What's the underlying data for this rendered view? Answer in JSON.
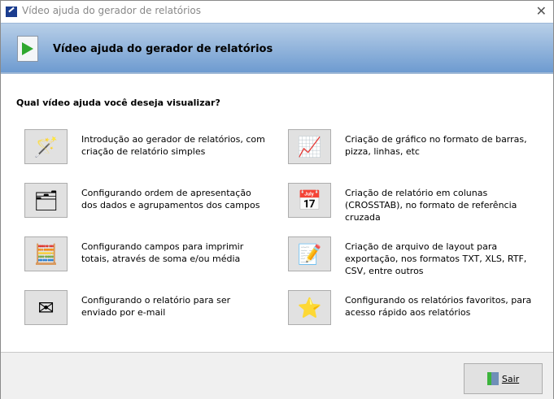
{
  "window": {
    "title": "Vídeo ajuda do gerador de relatórios"
  },
  "header": {
    "title": "Vídeo ajuda do gerador de relatórios"
  },
  "question": "Qual vídeo ajuda você deseja visualizar?",
  "options": [
    {
      "icon": "magic-wand-icon",
      "glyph": "🪄",
      "text": "Introdução ao gerador de relatórios, com criação de relatório simples"
    },
    {
      "icon": "chart-icon",
      "glyph": "📈",
      "text": "Criação de gráfico no formato de barras, pizza, linhas, etc"
    },
    {
      "icon": "tree-structure-icon",
      "glyph": "🗂",
      "text": "Configurando ordem de apresentação dos dados e agrupamentos dos campos"
    },
    {
      "icon": "table-grid-icon",
      "glyph": "📅",
      "text": "Criação de relatório em colunas (CROSSTAB), no formato de referência cruzada"
    },
    {
      "icon": "calculator-icon",
      "glyph": "🧮",
      "text": "Configurando campos para imprimir totais, através de soma e/ou média"
    },
    {
      "icon": "notepad-pencil-icon",
      "glyph": "📝",
      "text": "Criação de arquivo de layout para exportação, nos formatos TXT, XLS, RTF, CSV, entre outros"
    },
    {
      "icon": "envelope-icon",
      "glyph": "✉",
      "text": "Configurando o relatório para ser enviado por e-mail"
    },
    {
      "icon": "star-check-icon",
      "glyph": "⭐",
      "text": "Configurando os relatórios favoritos, para acesso rápido aos relatórios"
    }
  ],
  "footer": {
    "exit_label": "Sair"
  }
}
